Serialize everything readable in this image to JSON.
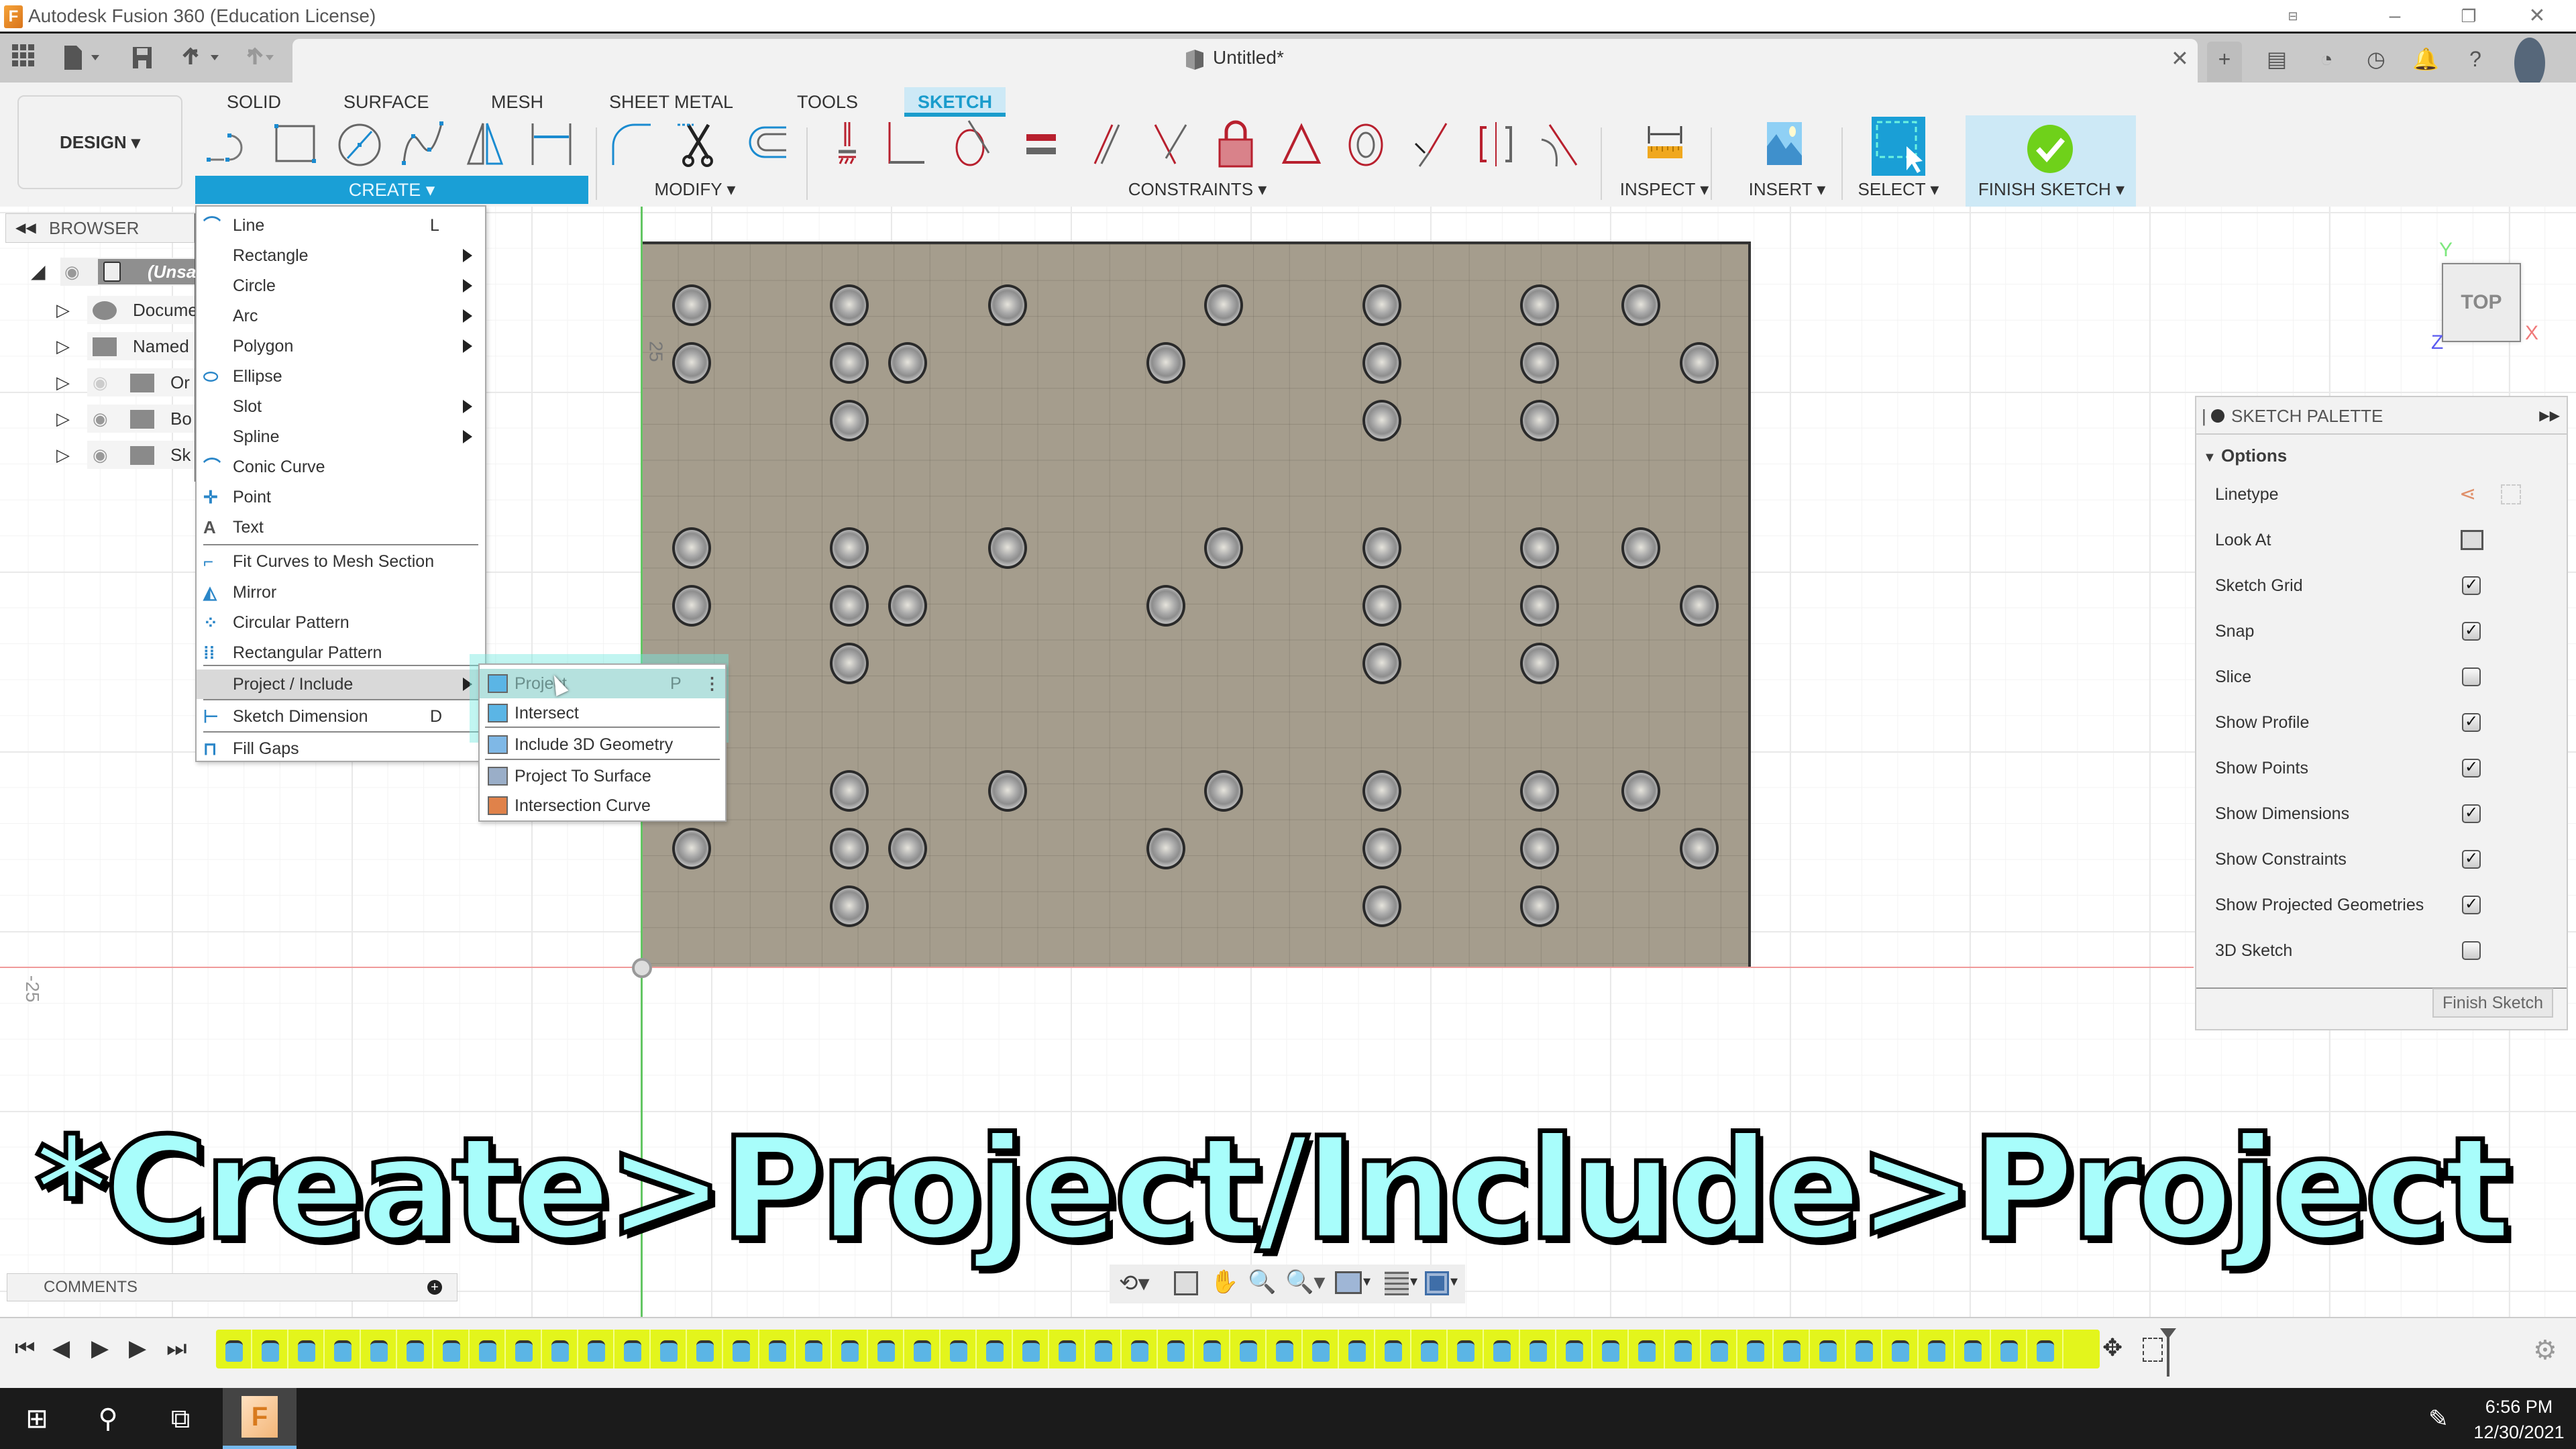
{
  "window": {
    "title": "Autodesk Fusion 360 (Education License)",
    "document_tab": "Untitled*",
    "controls": [
      "minimize",
      "restore",
      "close"
    ]
  },
  "quick_access": {
    "icons": [
      "app-grid-icon",
      "file-icon",
      "save-icon",
      "undo-icon",
      "redo-icon"
    ]
  },
  "right_tools": [
    "new-tab-icon",
    "comments-icon",
    "job-status-icon",
    "history-icon",
    "notifications-icon",
    "help-icon",
    "user-avatar"
  ],
  "workspace": {
    "label": "DESIGN"
  },
  "ribbon_tabs": [
    {
      "label": "SOLID",
      "active": false
    },
    {
      "label": "SURFACE",
      "active": false
    },
    {
      "label": "MESH",
      "active": false
    },
    {
      "label": "SHEET METAL",
      "active": false
    },
    {
      "label": "TOOLS",
      "active": false
    },
    {
      "label": "SKETCH",
      "active": true
    }
  ],
  "ribbon_groups": {
    "create": "CREATE",
    "modify": "MODIFY",
    "constraints": "CONSTRAINTS",
    "inspect": "INSPECT",
    "insert": "INSERT",
    "select": "SELECT",
    "finish": "FINISH SKETCH"
  },
  "colors": {
    "accent": "#1a9fd6",
    "finish_green": "#6fd11a",
    "constraint_red": "#b8202e",
    "overlay_text": "#a8fdfb",
    "plate": "#a59d8d",
    "timeline": "#e3f51c"
  },
  "browser": {
    "title": "BROWSER",
    "items": [
      {
        "label": "(Unsa",
        "icon": "component-icon"
      },
      {
        "label": "Docume",
        "icon": "gear-icon"
      },
      {
        "label": "Named",
        "icon": "folder-icon"
      },
      {
        "label": "Or",
        "icon": "folder-icon"
      },
      {
        "label": "Bo",
        "icon": "folder-icon"
      },
      {
        "label": "Sk",
        "icon": "folder-icon"
      }
    ]
  },
  "create_menu": {
    "items": [
      {
        "label": "Line",
        "shortcut": "L",
        "submenu": false
      },
      {
        "label": "Rectangle",
        "shortcut": "",
        "submenu": true
      },
      {
        "label": "Circle",
        "shortcut": "",
        "submenu": true
      },
      {
        "label": "Arc",
        "shortcut": "",
        "submenu": true
      },
      {
        "label": "Polygon",
        "shortcut": "",
        "submenu": true
      },
      {
        "label": "Ellipse",
        "shortcut": "",
        "submenu": false
      },
      {
        "label": "Slot",
        "shortcut": "",
        "submenu": true
      },
      {
        "label": "Spline",
        "shortcut": "",
        "submenu": true
      },
      {
        "label": "Conic Curve",
        "shortcut": "",
        "submenu": false
      },
      {
        "label": "Point",
        "shortcut": "",
        "submenu": false
      },
      {
        "label": "Text",
        "shortcut": "",
        "submenu": false
      },
      {
        "label": "Fit Curves to Mesh Section",
        "shortcut": "",
        "submenu": false
      },
      {
        "label": "Mirror",
        "shortcut": "",
        "submenu": false
      },
      {
        "label": "Circular Pattern",
        "shortcut": "",
        "submenu": false
      },
      {
        "label": "Rectangular Pattern",
        "shortcut": "",
        "submenu": false
      },
      {
        "label": "Project / Include",
        "shortcut": "",
        "submenu": true,
        "highlighted": true
      },
      {
        "label": "Sketch Dimension",
        "shortcut": "D",
        "submenu": false
      },
      {
        "label": "Fill Gaps",
        "shortcut": "",
        "submenu": false
      }
    ]
  },
  "project_submenu": {
    "items": [
      {
        "label": "Project",
        "shortcut": "P",
        "hovered": true
      },
      {
        "label": "Intersect",
        "shortcut": ""
      },
      {
        "label": "Include 3D Geometry",
        "shortcut": ""
      },
      {
        "label": "Project To Surface",
        "shortcut": ""
      },
      {
        "label": "Intersection Curve",
        "shortcut": ""
      }
    ]
  },
  "canvas": {
    "dimension_label_y": "25",
    "dimension_label_x": "-25",
    "view_cube": {
      "face": "TOP",
      "x": "X",
      "y": "Y",
      "z": "Z"
    }
  },
  "sketch_palette": {
    "title": "SKETCH PALETTE",
    "section": "Options",
    "rows": [
      {
        "label": "Linetype",
        "type": "icons"
      },
      {
        "label": "Look At",
        "type": "icon"
      },
      {
        "label": "Sketch Grid",
        "type": "checkbox",
        "checked": true
      },
      {
        "label": "Snap",
        "type": "checkbox",
        "checked": true
      },
      {
        "label": "Slice",
        "type": "checkbox",
        "checked": false
      },
      {
        "label": "Show Profile",
        "type": "checkbox",
        "checked": true
      },
      {
        "label": "Show Points",
        "type": "checkbox",
        "checked": true
      },
      {
        "label": "Show Dimensions",
        "type": "checkbox",
        "checked": true
      },
      {
        "label": "Show Constraints",
        "type": "checkbox",
        "checked": true
      },
      {
        "label": "Show Projected Geometries",
        "type": "checkbox",
        "checked": true
      },
      {
        "label": "3D Sketch",
        "type": "checkbox",
        "checked": false
      }
    ],
    "finish_button": "Finish Sketch"
  },
  "overlay_caption": "*Create>Project/Include>Project",
  "comments": {
    "label": "COMMENTS"
  },
  "timeline": {
    "feature_count": 51
  },
  "taskbar": {
    "time": "6:56 PM",
    "date": "12/30/2021"
  }
}
